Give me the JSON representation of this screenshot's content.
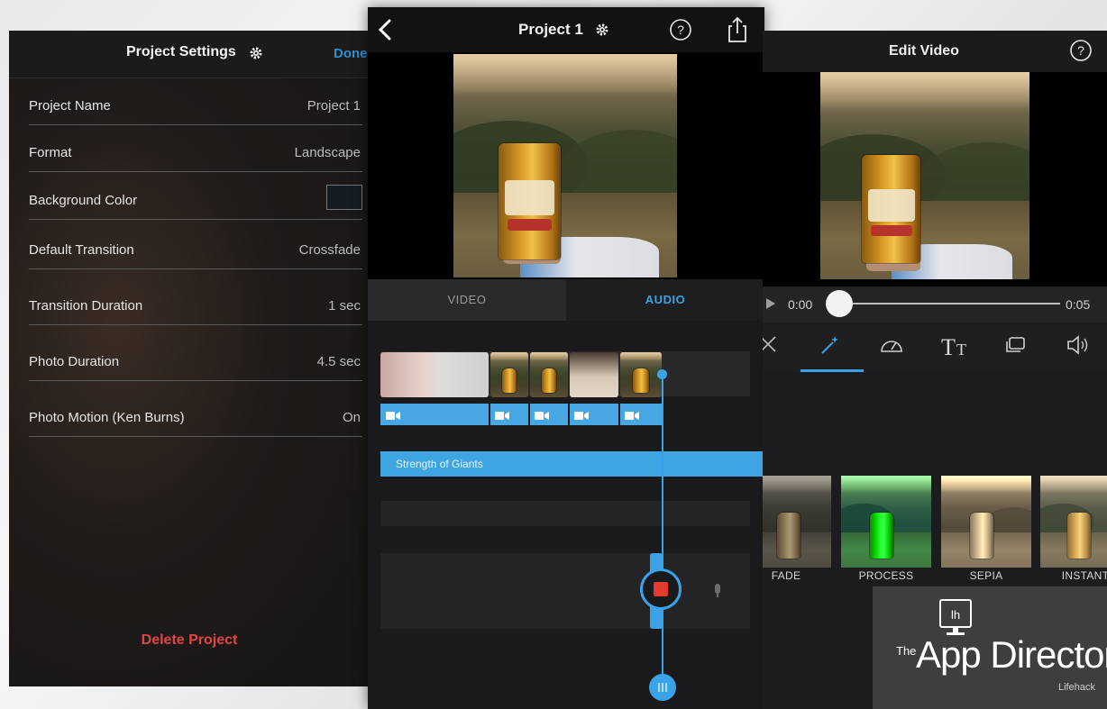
{
  "settings": {
    "title": "Project Settings",
    "done_label": "Done",
    "rows": [
      {
        "label": "Project Name",
        "value": "Project 1"
      },
      {
        "label": "Format",
        "value": "Landscape"
      },
      {
        "label": "Background Color",
        "value": ""
      },
      {
        "label": "Default Transition",
        "value": "Crossfade"
      },
      {
        "label": "Transition Duration",
        "value": "1 sec"
      },
      {
        "label": "Photo Duration",
        "value": "4.5 sec"
      },
      {
        "label": "Photo Motion (Ken Burns)",
        "value": "On"
      }
    ],
    "background_color": "#141c24",
    "delete_label": "Delete Project"
  },
  "project": {
    "title": "Project 1",
    "tabs": [
      {
        "label": "VIDEO",
        "active": false
      },
      {
        "label": "AUDIO",
        "active": true
      }
    ],
    "audio_track_label": "Strength of Giants"
  },
  "editor": {
    "title": "Edit Video",
    "time_start": "0:00",
    "time_end": "0:05",
    "scrub_position": 0.0,
    "tools": [
      "scissors-icon",
      "magic-wand-icon",
      "speedometer-icon",
      "text-size-icon",
      "layers-icon",
      "volume-icon"
    ],
    "active_tool": "magic-wand-icon",
    "filters": [
      {
        "label": "FADE"
      },
      {
        "label": "PROCESS"
      },
      {
        "label": "SEPIA"
      },
      {
        "label": "INSTANT"
      }
    ]
  },
  "watermark": {
    "monogram": "lh",
    "prefix": "The",
    "brand": "App Director",
    "sub": "Lifehack"
  },
  "colors": {
    "accent": "#3aa3e8",
    "record": "#e53a2e",
    "delete": "#e14545"
  }
}
